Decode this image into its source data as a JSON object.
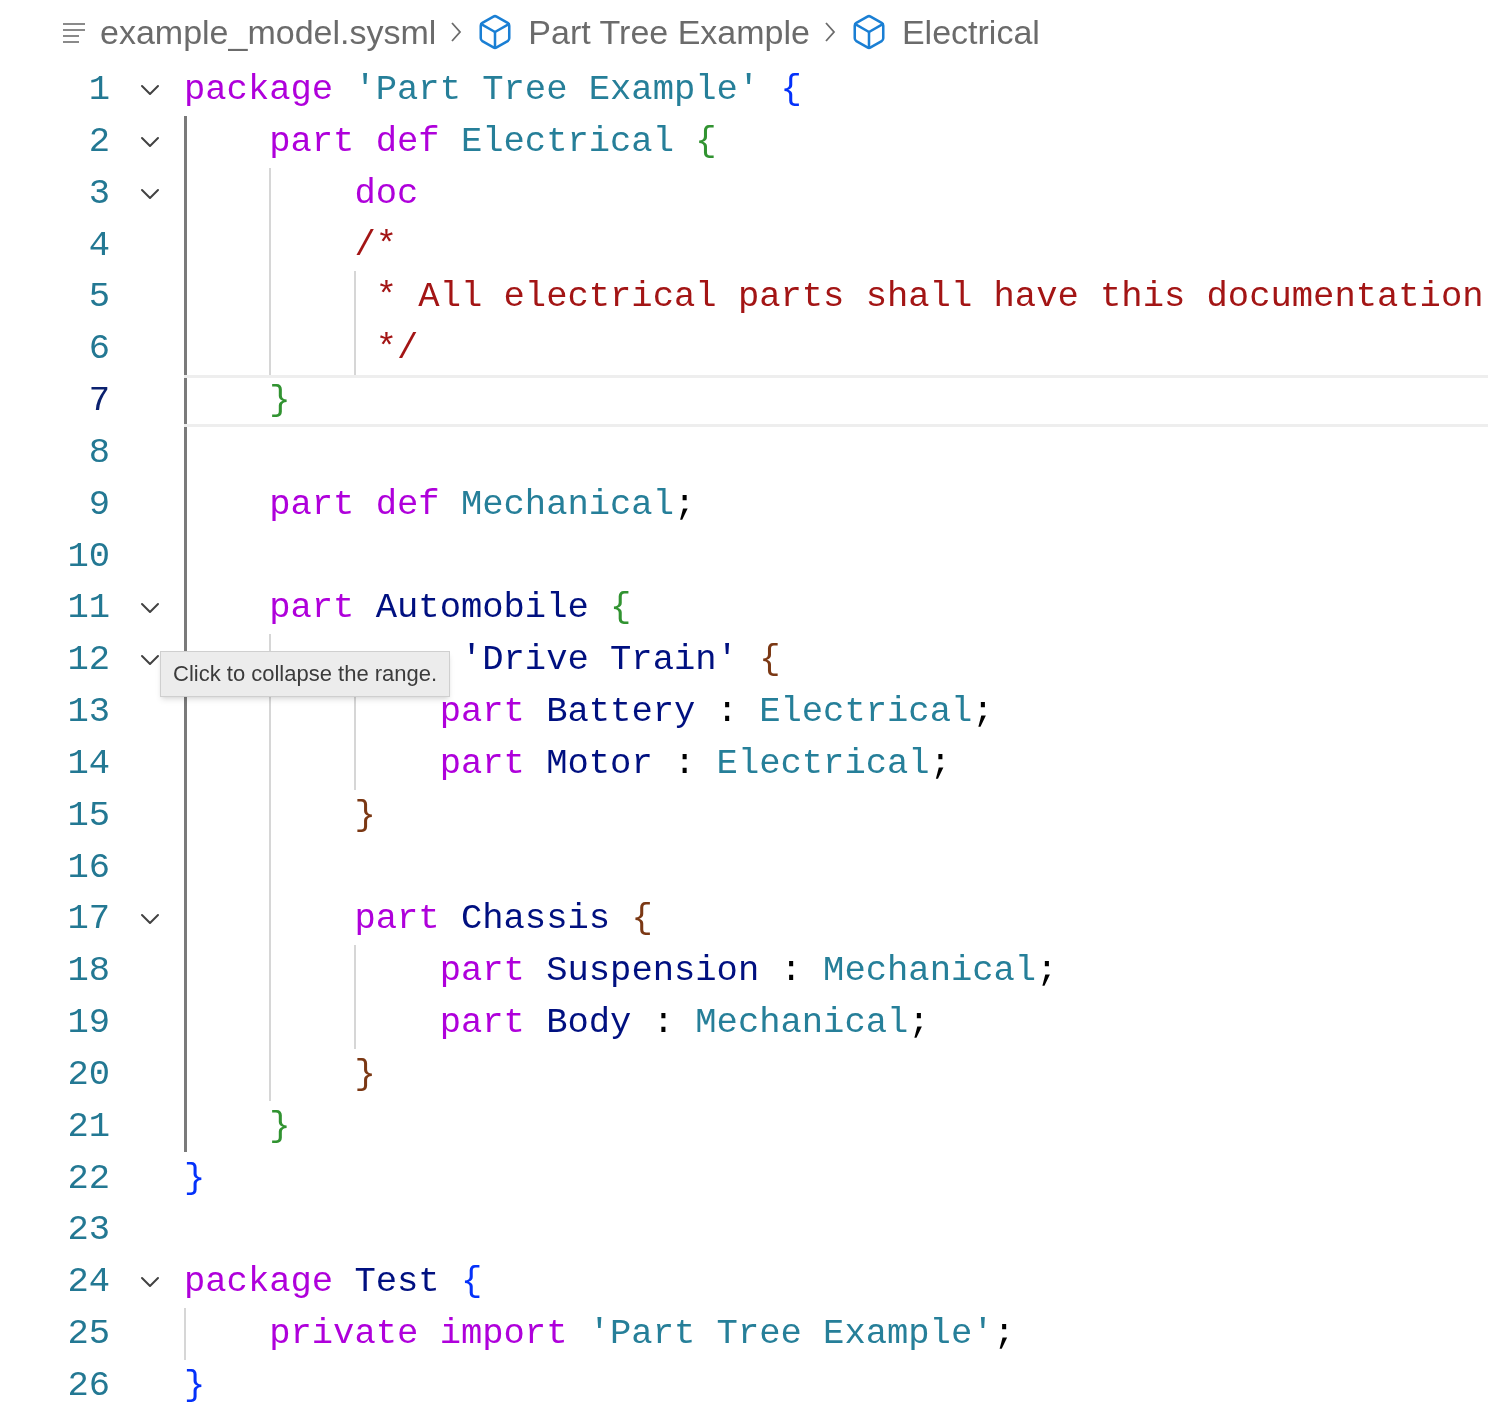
{
  "breadcrumb": [
    {
      "kind": "file",
      "label": "example_model.sysml"
    },
    {
      "kind": "symbol",
      "label": "Part Tree Example"
    },
    {
      "kind": "symbol",
      "label": "Electrical"
    }
  ],
  "editor": {
    "lines": [
      {
        "number": "1",
        "kind": "code",
        "foldable": true,
        "current": false,
        "tokens": [
          {
            "kind": "kw",
            "t": "package"
          },
          {
            "kind": "str",
            "t": " 'Part Tree Example'"
          },
          {
            "kind": "brace1",
            "t": " {"
          }
        ]
      },
      {
        "number": "2",
        "kind": "code",
        "foldable": true,
        "current": false,
        "guides": [
          true
        ],
        "tokens": [
          {
            "kind": "kw",
            "t": "part def"
          },
          {
            "kind": "type",
            "t": " Electrical"
          },
          {
            "kind": "brace2",
            "t": " {"
          }
        ]
      },
      {
        "number": "3",
        "kind": "code",
        "foldable": true,
        "current": false,
        "guides": [
          true,
          false
        ],
        "tokens": [
          {
            "kind": "kw",
            "t": "doc"
          }
        ]
      },
      {
        "number": "4",
        "kind": "code",
        "foldable": false,
        "current": false,
        "guides": [
          true,
          false
        ],
        "tokens": [
          {
            "kind": "comment",
            "t": "/*"
          }
        ]
      },
      {
        "number": "5",
        "kind": "comment_body",
        "foldable": false,
        "current": false,
        "guides": [
          true,
          false,
          false
        ],
        "tokens": [
          {
            "kind": "comment",
            "t": " * All electrical parts shall have this documentation"
          }
        ]
      },
      {
        "number": "6",
        "kind": "comment_body",
        "foldable": false,
        "current": false,
        "guides": [
          true,
          false,
          false
        ],
        "tokens": [
          {
            "kind": "comment",
            "t": " */"
          }
        ]
      },
      {
        "number": "7",
        "kind": "code",
        "foldable": false,
        "current": true,
        "guides": [
          true
        ],
        "tokens": [
          {
            "kind": "brace2",
            "t": "}"
          }
        ]
      },
      {
        "number": "8",
        "foldable": false,
        "current": false,
        "guides": [
          true
        ]
      },
      {
        "number": "9",
        "kind": "code",
        "foldable": false,
        "current": false,
        "guides": [
          true
        ],
        "tokens": [
          {
            "kind": "kw",
            "t": "part def"
          },
          {
            "kind": "type",
            "t": " Mechanical"
          },
          {
            "kind": "punct",
            "t": ";"
          }
        ]
      },
      {
        "number": "10",
        "foldable": false,
        "current": false,
        "guides": [
          true
        ]
      },
      {
        "number": "11",
        "kind": "code",
        "foldable": true,
        "current": false,
        "guides": [
          true
        ],
        "tokens": [
          {
            "kind": "kw",
            "t": "part"
          },
          {
            "kind": "name",
            "t": " Automobile"
          },
          {
            "kind": "brace2",
            "t": " {"
          }
        ]
      },
      {
        "number": "12",
        "kind": "covered_start",
        "foldable": true,
        "current": false,
        "guides": [
          true,
          false
        ],
        "tokens": [
          {
            "kind": "name",
            "t": "'Drive Train'"
          },
          {
            "kind": "brace3",
            "t": " {"
          }
        ]
      },
      {
        "number": "13",
        "kind": "code",
        "foldable": false,
        "current": false,
        "guides": [
          true,
          false,
          false
        ],
        "tokens": [
          {
            "kind": "kw",
            "t": "part"
          },
          {
            "kind": "name",
            "t": " Battery"
          },
          {
            "kind": "punct",
            "t": " :"
          },
          {
            "kind": "type",
            "t": " Electrical"
          },
          {
            "kind": "punct",
            "t": ";"
          }
        ]
      },
      {
        "number": "14",
        "kind": "code",
        "foldable": false,
        "current": false,
        "guides": [
          true,
          false,
          false
        ],
        "tokens": [
          {
            "kind": "kw",
            "t": "part"
          },
          {
            "kind": "name",
            "t": " Motor"
          },
          {
            "kind": "punct",
            "t": " :"
          },
          {
            "kind": "type",
            "t": " Electrical"
          },
          {
            "kind": "punct",
            "t": ";"
          }
        ]
      },
      {
        "number": "15",
        "kind": "code",
        "foldable": false,
        "current": false,
        "guides": [
          true,
          false
        ],
        "tokens": [
          {
            "kind": "brace3",
            "t": "}"
          }
        ]
      },
      {
        "number": "16",
        "foldable": false,
        "current": false,
        "guides": [
          true,
          false
        ]
      },
      {
        "number": "17",
        "kind": "code",
        "foldable": true,
        "current": false,
        "guides": [
          true,
          false
        ],
        "tokens": [
          {
            "kind": "kw",
            "t": "part"
          },
          {
            "kind": "name",
            "t": " Chassis"
          },
          {
            "kind": "brace3",
            "t": " {"
          }
        ]
      },
      {
        "number": "18",
        "kind": "code",
        "foldable": false,
        "current": false,
        "guides": [
          true,
          false,
          false
        ],
        "tokens": [
          {
            "kind": "kw",
            "t": "part"
          },
          {
            "kind": "name",
            "t": " Suspension"
          },
          {
            "kind": "punct",
            "t": " :"
          },
          {
            "kind": "type",
            "t": " Mechanical"
          },
          {
            "kind": "punct",
            "t": ";"
          }
        ]
      },
      {
        "number": "19",
        "kind": "code",
        "foldable": false,
        "current": false,
        "guides": [
          true,
          false,
          false
        ],
        "tokens": [
          {
            "kind": "kw",
            "t": "part"
          },
          {
            "kind": "name",
            "t": " Body"
          },
          {
            "kind": "punct",
            "t": " :"
          },
          {
            "kind": "type",
            "t": " Mechanical"
          },
          {
            "kind": "punct",
            "t": ";"
          }
        ]
      },
      {
        "number": "20",
        "kind": "code",
        "foldable": false,
        "current": false,
        "guides": [
          true,
          false
        ],
        "tokens": [
          {
            "kind": "brace3",
            "t": "}"
          }
        ]
      },
      {
        "number": "21",
        "kind": "code",
        "foldable": false,
        "current": false,
        "guides": [
          true
        ],
        "tokens": [
          {
            "kind": "brace2",
            "t": "}"
          }
        ]
      },
      {
        "number": "22",
        "kind": "code",
        "foldable": false,
        "current": false,
        "tokens": [
          {
            "kind": "brace1",
            "t": "}"
          }
        ]
      },
      {
        "number": "23",
        "foldable": false,
        "current": false
      },
      {
        "number": "24",
        "kind": "code",
        "foldable": true,
        "current": false,
        "tokens": [
          {
            "kind": "kw",
            "t": "package"
          },
          {
            "kind": "name",
            "t": " Test"
          },
          {
            "kind": "brace1",
            "t": " {"
          }
        ]
      },
      {
        "number": "25",
        "kind": "code",
        "foldable": false,
        "current": false,
        "guides": [
          false
        ],
        "tokens": [
          {
            "kind": "kw",
            "t": "private import"
          },
          {
            "kind": "str",
            "t": " 'Part Tree Example'"
          },
          {
            "kind": "punct",
            "t": ";"
          }
        ]
      },
      {
        "number": "26",
        "kind": "code",
        "foldable": false,
        "current": false,
        "tokens": [
          {
            "kind": "brace1",
            "t": "}"
          }
        ]
      }
    ]
  },
  "tooltip": {
    "text": "Click to collapse the range."
  }
}
